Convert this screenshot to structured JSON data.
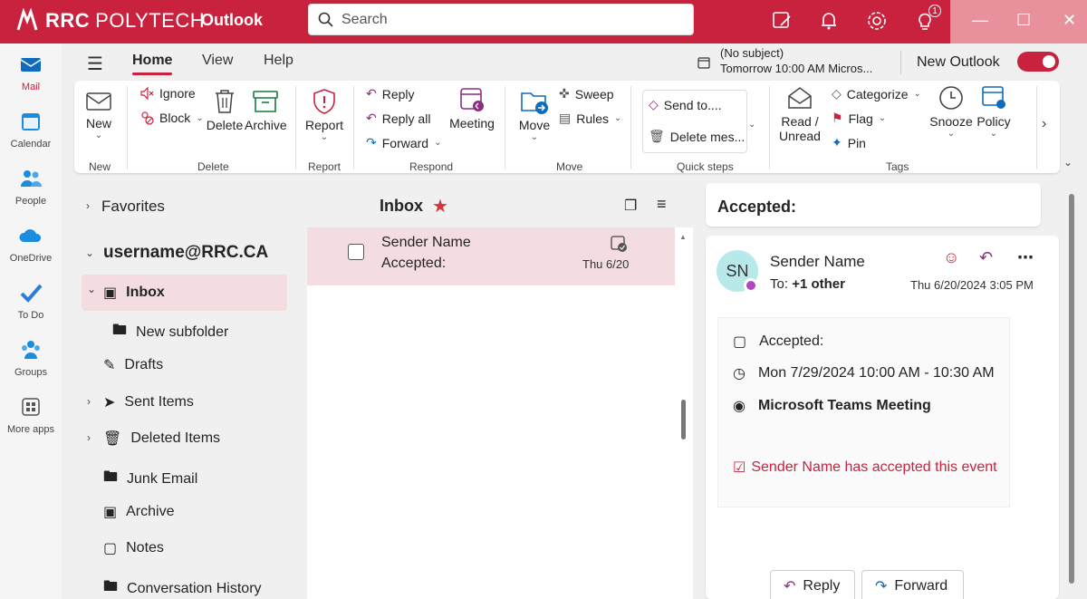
{
  "titlebar": {
    "brand_main": "RRC",
    "brand_sub": "POLYTECH",
    "app_name": "Outlook",
    "notification_count": "1"
  },
  "search": {
    "placeholder": "Search"
  },
  "rail": {
    "items": [
      {
        "label": "Mail",
        "icon": "mail-icon",
        "active": true
      },
      {
        "label": "Calendar",
        "icon": "calendar-icon"
      },
      {
        "label": "People",
        "icon": "people-icon"
      },
      {
        "label": "OneDrive",
        "icon": "cloud-icon"
      },
      {
        "label": "To Do",
        "icon": "check-icon"
      },
      {
        "label": "Groups",
        "icon": "groups-icon"
      },
      {
        "label": "More apps",
        "icon": "apps-icon"
      }
    ]
  },
  "ribbon_tabs": {
    "home": "Home",
    "view": "View",
    "help": "Help"
  },
  "reminder": {
    "title": "(No subject)",
    "time": "Tomorrow 10:00 AM Micros..."
  },
  "new_outlook": {
    "label": "New Outlook"
  },
  "ribbon": {
    "new": "New",
    "ignore": "Ignore",
    "block": "Block",
    "delete": "Delete",
    "archive": "Archive",
    "report": "Report",
    "reply": "Reply",
    "reply_all": "Reply all",
    "forward": "Forward",
    "meeting": "Meeting",
    "move": "Move",
    "sweep": "Sweep",
    "rules": "Rules",
    "send_to": "Send to....",
    "delete_mes": "Delete mes...",
    "read_unread_1": "Read /",
    "read_unread_2": "Unread",
    "categorize": "Categorize",
    "flag": "Flag",
    "pin": "Pin",
    "snooze": "Snooze",
    "policy": "Policy",
    "groups": {
      "new": "New",
      "delete": "Delete",
      "report": "Report",
      "respond": "Respond",
      "move": "Move",
      "quick_steps": "Quick steps",
      "tags": "Tags"
    }
  },
  "folders": {
    "favorites": "Favorites",
    "account": "username@RRC.CA",
    "inbox": "Inbox",
    "new_subfolder": "New subfolder",
    "drafts": "Drafts",
    "sent_items": "Sent Items",
    "deleted_items": "Deleted Items",
    "junk_email": "Junk Email",
    "archive": "Archive",
    "notes": "Notes",
    "conversation_history": "Conversation History"
  },
  "message_list": {
    "title": "Inbox",
    "messages": [
      {
        "sender": "Sender Name",
        "subject": "Accepted:",
        "date": "Thu 6/20"
      }
    ]
  },
  "reading_pane": {
    "subject": "Accepted:",
    "avatar_initials": "SN",
    "sender": "Sender Name",
    "to_label": "To:",
    "to_value": "+1 other",
    "date": "Thu 6/20/2024 3:05 PM",
    "event_title": "Accepted:",
    "event_time": "Mon 7/29/2024 10:00 AM - 10:30 AM",
    "event_location": "Microsoft Teams Meeting",
    "accepted_text": "Sender Name has accepted this event",
    "reply_button": "Reply",
    "forward_button": "Forward"
  },
  "colors": {
    "accent": "#c8223f",
    "selection": "#f4dde1"
  }
}
